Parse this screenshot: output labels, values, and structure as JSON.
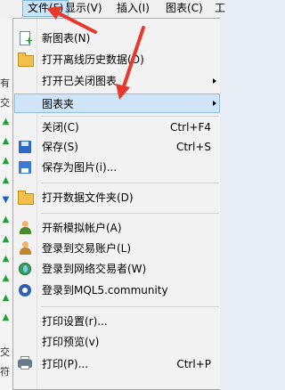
{
  "menubar": {
    "items": [
      {
        "label": "文件(F)"
      },
      {
        "label": "显示(V)"
      },
      {
        "label": "插入(I)"
      },
      {
        "label": "图表(C)"
      },
      {
        "label": "工"
      }
    ]
  },
  "background": {
    "labels": [
      "有",
      "交",
      "交",
      "符"
    ]
  },
  "menu": {
    "items": [
      {
        "label": "新图表(N)",
        "icon": "new-chart-icon"
      },
      {
        "label": "打开离线历史数据(O)",
        "icon": "folder-icon"
      },
      {
        "label": "打开已关闭图表",
        "icon": "",
        "submenu": true
      },
      {
        "label": "图表夹",
        "icon": "",
        "submenu": true
      },
      {
        "label": "关闭(C)",
        "icon": "",
        "shortcut": "Ctrl+F4"
      },
      {
        "label": "保存(S)",
        "icon": "save-icon",
        "shortcut": "Ctrl+S"
      },
      {
        "label": "保存为图片(i)...",
        "icon": "save-picture-icon"
      },
      {
        "label": "打开数据文件夹(D)",
        "icon": "folder-icon"
      },
      {
        "label": "开新模拟帐户(A)",
        "icon": "new-account-icon"
      },
      {
        "label": "登录到交易账户(L)",
        "icon": "login-icon"
      },
      {
        "label": "登录到网络交易者(W)",
        "icon": "web-trader-icon"
      },
      {
        "label": "登录到MQL5.community",
        "icon": "mql5-icon"
      },
      {
        "label": "打印设置(r)...",
        "icon": ""
      },
      {
        "label": "打印预览(v)",
        "icon": ""
      },
      {
        "label": "打印(P)...",
        "icon": "printer-icon",
        "shortcut": "Ctrl+P"
      }
    ]
  },
  "colors": {
    "highlight": "#cfe4f6",
    "annotation_arrow": "#e8372b"
  }
}
